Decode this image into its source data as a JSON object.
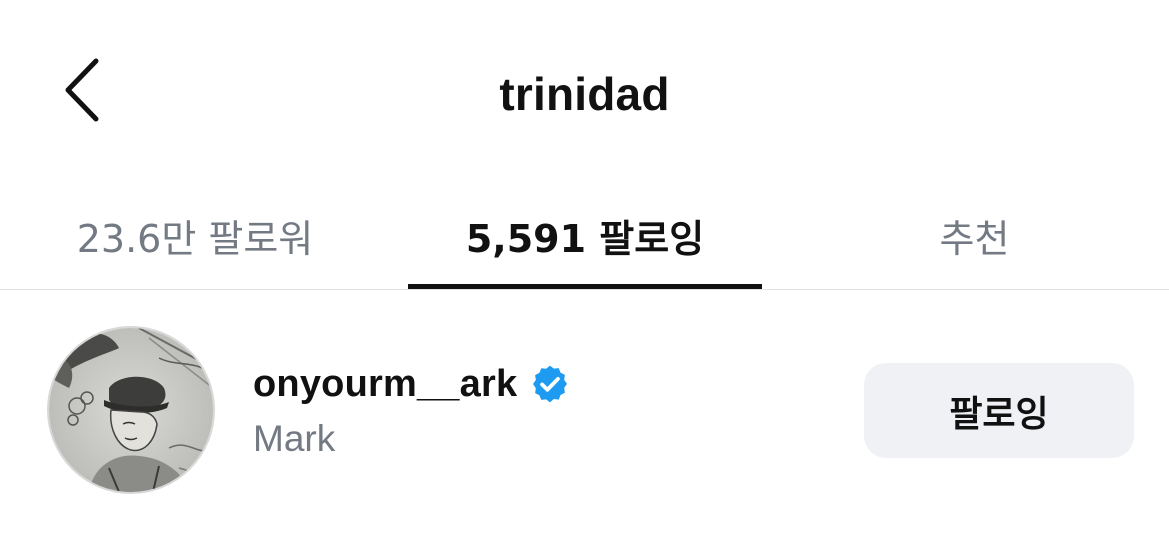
{
  "header": {
    "title": "trinidad",
    "back_icon": "chevron-left-icon"
  },
  "tabs": [
    {
      "label": "23.6만 팔로워",
      "active": false
    },
    {
      "label": "5,591 팔로잉",
      "active": true
    },
    {
      "label": "추천",
      "active": false
    }
  ],
  "following_list": [
    {
      "username": "onyourm__ark",
      "display_name": "Mark",
      "verified": true,
      "button_label": "팔로잉",
      "avatar": "sketch-portrait-avatar"
    }
  ],
  "colors": {
    "text_primary": "#111111",
    "text_secondary": "#737a83",
    "verified_badge": "#1d9bf0",
    "button_bg": "#eff1f4",
    "tab_indicator": "#111111"
  }
}
